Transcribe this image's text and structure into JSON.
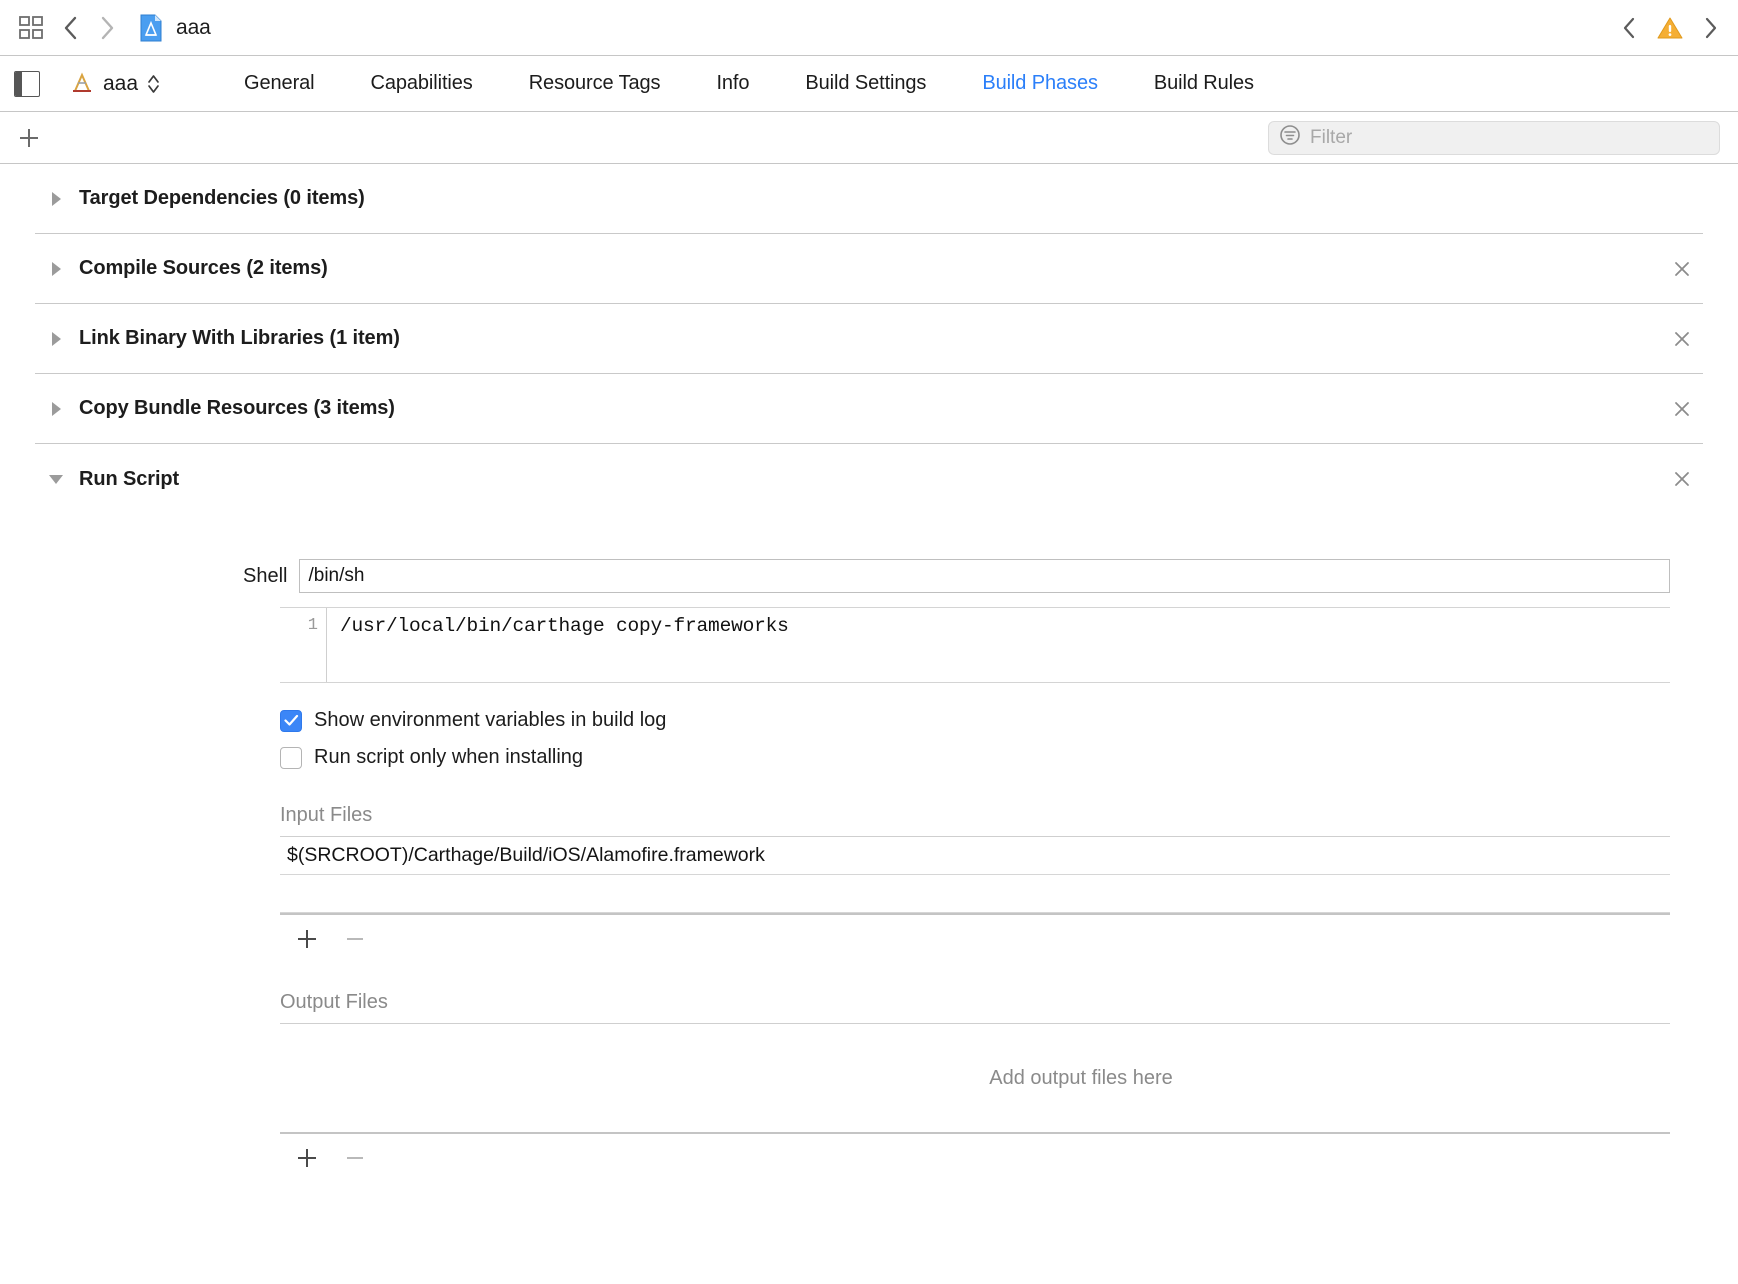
{
  "toolbar": {
    "grid_icon": "grid-view-icon",
    "back_icon": "chevron-left-icon",
    "forward_icon": "chevron-right-icon",
    "document_icon": "xcode-project-icon",
    "document_title": "aaa",
    "issue_prev_icon": "chevron-left-icon",
    "warning_icon": "warning-triangle-icon",
    "issue_next_icon": "chevron-right-icon"
  },
  "tabbar": {
    "panel_toggle_icon": "navigator-panel-toggle-icon",
    "target_icon": "xcode-target-icon",
    "target_name": "aaa",
    "stepper_icon": "up-down-stepper-icon",
    "tabs": [
      {
        "label": "General",
        "active": false
      },
      {
        "label": "Capabilities",
        "active": false
      },
      {
        "label": "Resource Tags",
        "active": false
      },
      {
        "label": "Info",
        "active": false
      },
      {
        "label": "Build Settings",
        "active": false
      },
      {
        "label": "Build Phases",
        "active": true
      },
      {
        "label": "Build Rules",
        "active": false
      }
    ]
  },
  "filterbar": {
    "add_icon": "plus-icon",
    "filter_icon": "filter-icon",
    "filter_placeholder": "Filter",
    "filter_value": ""
  },
  "phases": [
    {
      "title": "Target Dependencies (0 items)",
      "expanded": false,
      "closable": false
    },
    {
      "title": "Compile Sources (2 items)",
      "expanded": false,
      "closable": true
    },
    {
      "title": "Link Binary With Libraries (1 item)",
      "expanded": false,
      "closable": true
    },
    {
      "title": "Copy Bundle Resources (3 items)",
      "expanded": false,
      "closable": true
    },
    {
      "title": "Run Script",
      "expanded": true,
      "closable": true
    }
  ],
  "run_script": {
    "shell_label": "Shell",
    "shell_value": "/bin/sh",
    "script_line_number": "1",
    "script_text": "/usr/local/bin/carthage copy-frameworks",
    "show_env_label": "Show environment variables in build log",
    "show_env_checked": true,
    "install_only_label": "Run script only when installing",
    "install_only_checked": false,
    "input_files_label": "Input Files",
    "input_files": [
      "$(SRCROOT)/Carthage/Build/iOS/Alamofire.framework",
      ""
    ],
    "input_add_icon": "plus-icon",
    "input_remove_icon": "minus-icon",
    "output_files_label": "Output Files",
    "output_files_empty_text": "Add output files here",
    "output_add_icon": "plus-icon",
    "output_remove_icon": "minus-icon",
    "close_icon": "close-x-icon"
  },
  "colors": {
    "accent_blue": "#2b7ff9",
    "checkbox_blue": "#3b86f7",
    "warning_yellow": "#f5a623",
    "text": "#1c1c1c",
    "muted_text": "#8a8a8a",
    "rule": "#c9c9c9"
  }
}
